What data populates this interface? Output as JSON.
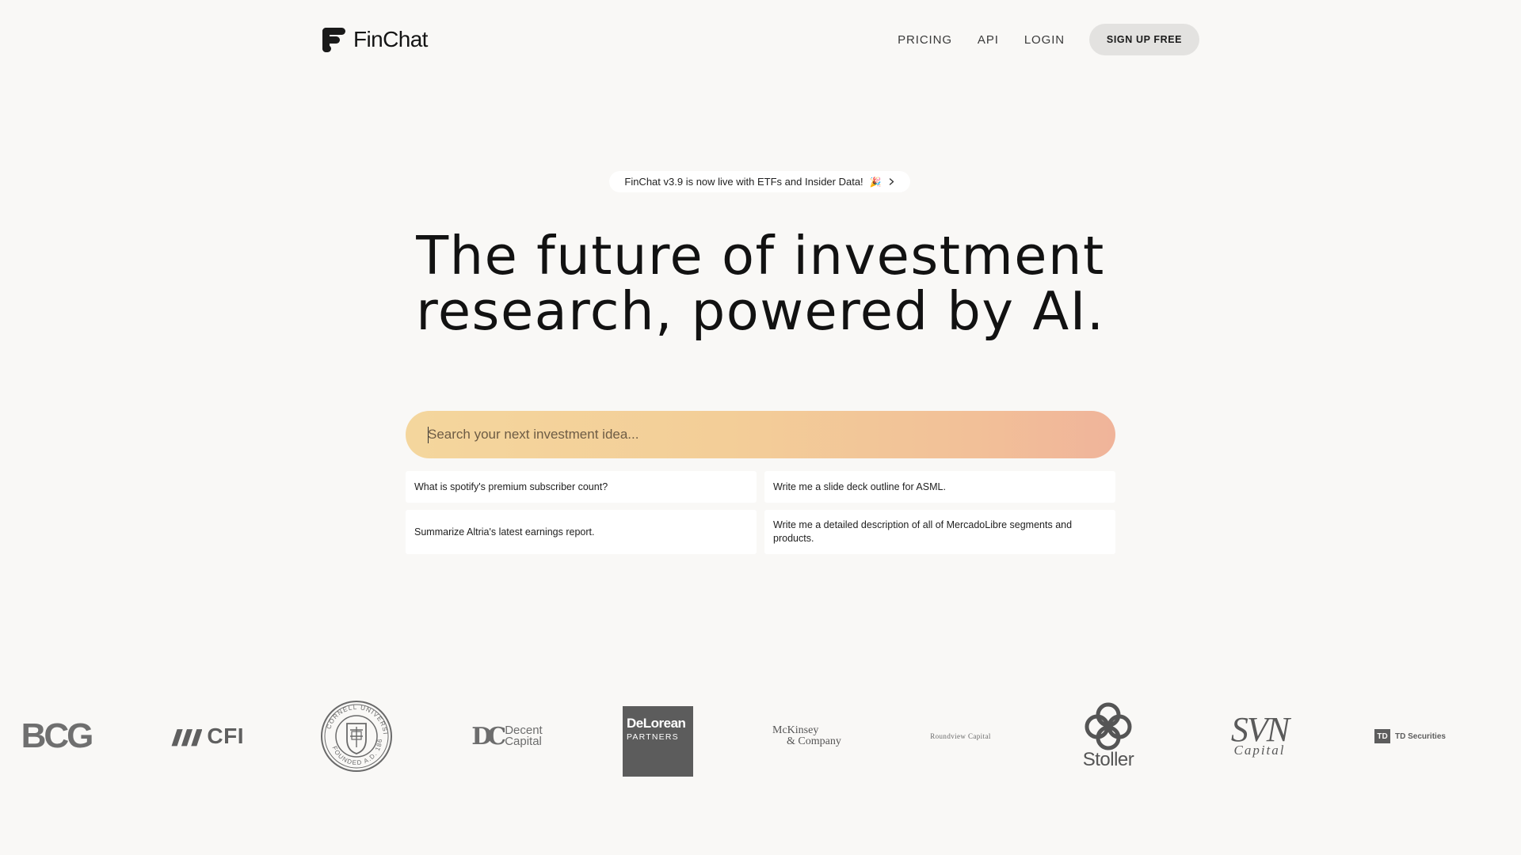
{
  "nav": {
    "brand": "FinChat",
    "links": [
      "PRICING",
      "API",
      "LOGIN"
    ],
    "signup_label": "SIGN UP FREE"
  },
  "announcement": {
    "text": "FinChat v3.9 is now live with ETFs and Insider Data!",
    "emoji": "🎉"
  },
  "hero": {
    "line1": "The future of investment",
    "line2": "research, powered by AI."
  },
  "search": {
    "placeholder": "Search your next investment idea..."
  },
  "suggestions": [
    "What is spotify's premium subscriber count?",
    "Write me a slide deck outline for ASML.",
    "Summarize Altria's latest earnings report.",
    "Write me a detailed description of all of MercadoLibre segments and products."
  ],
  "logos": {
    "bcg": "BCG",
    "cfi": "CFI",
    "cornell": "CORNELL UNIVERSITY FOUNDED A.D. 1865",
    "decent_mark": "DC",
    "decent_1": "Decent",
    "decent_2": "Capital",
    "delorean_1": "DeLorean",
    "delorean_2": "PARTNERS",
    "mckinsey_1": "McKinsey",
    "mckinsey_2": "& Company",
    "roundview": "Roundview Capital",
    "stoller": "Stoller",
    "svn_1": "SVN",
    "svn_2": "Capital",
    "td_mark": "TD",
    "td": "TD Securities"
  },
  "colors": {
    "background": "#f9f8f6",
    "search_gradient_start": "#f4d69d",
    "search_gradient_end": "#f0b49a",
    "signup_bg": "#e3e2e0"
  }
}
